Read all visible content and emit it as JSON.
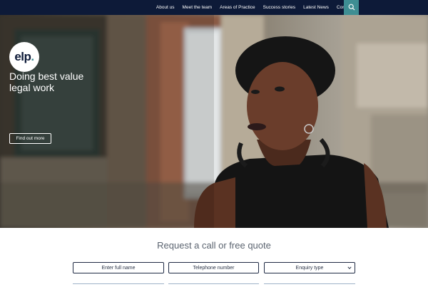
{
  "nav": {
    "items": [
      "About us",
      "Meet the team",
      "Areas of Practice",
      "Success stories",
      "Latest News",
      "Contact us"
    ],
    "search_icon": "search-icon",
    "bg_color": "#0d1a38",
    "accent_color": "#3e8e93"
  },
  "hero": {
    "logo_main": "elp",
    "logo_dot": ".",
    "tagline_line1": "Doing best value",
    "tagline_line2": "legal work",
    "cta_label": "Find out more"
  },
  "form": {
    "title": "Request a call or free quote",
    "name_placeholder": "Enter full name",
    "phone_placeholder": "Telephone number",
    "enquiry_selected": "Enquiry type",
    "enquiry_icon": "chevron-down-icon"
  }
}
